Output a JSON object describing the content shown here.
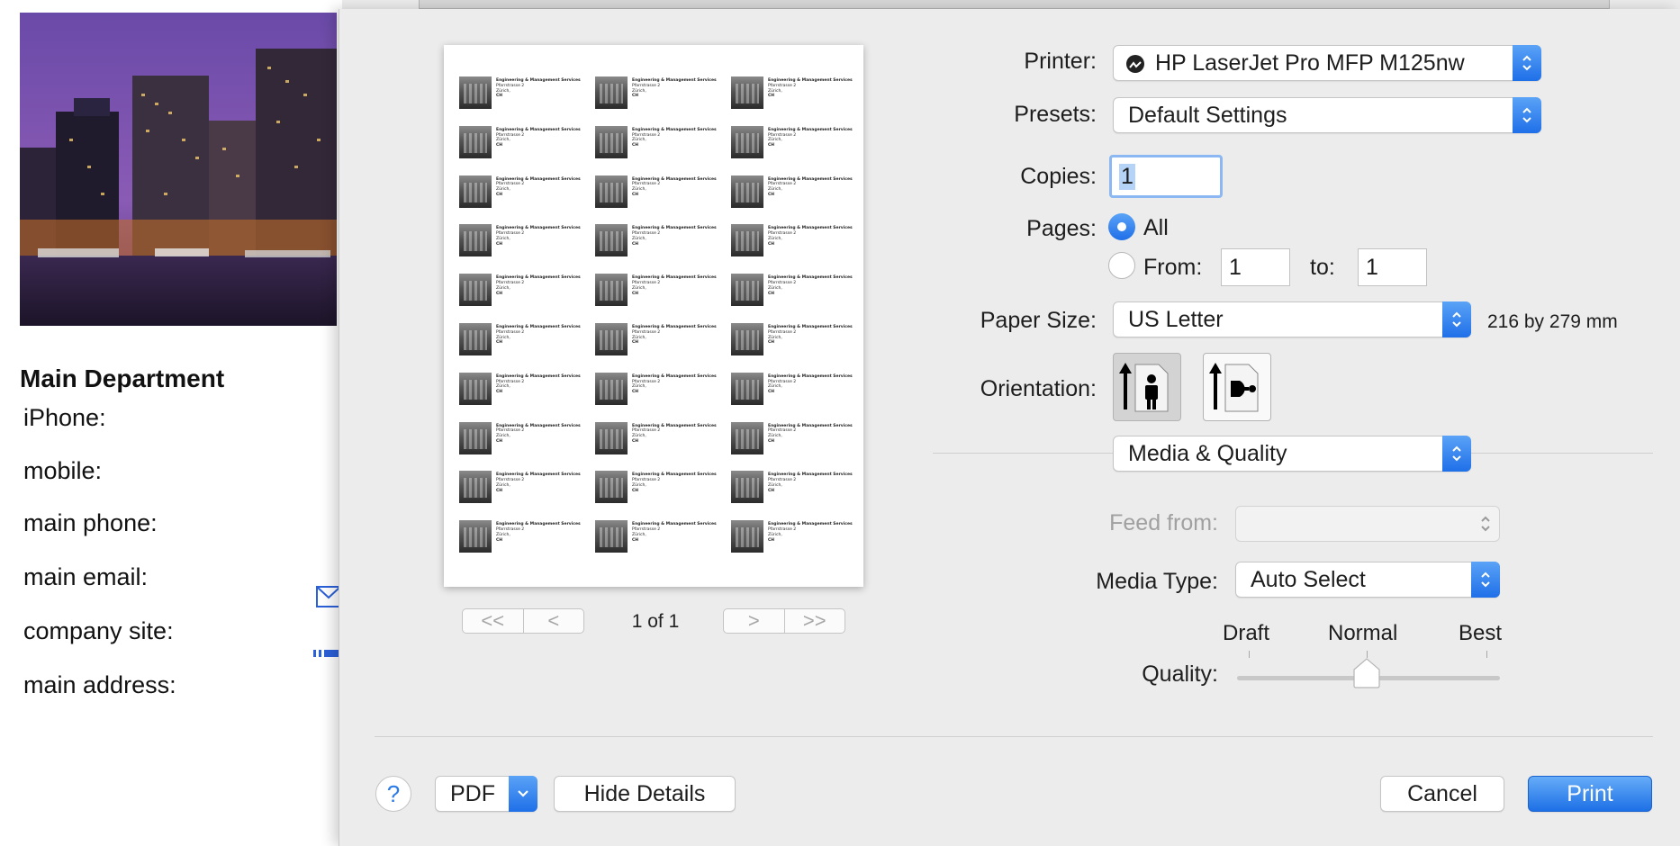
{
  "background_app": {
    "department_title": "Main Department",
    "labels": [
      "iPhone:",
      "mobile:",
      "main phone:",
      "main email:",
      "company site:",
      "main address:"
    ]
  },
  "preview": {
    "label_lines": [
      "Engineering & Management Services",
      "Pfarrstrasse 2",
      "Zürich,",
      "CH"
    ],
    "pager": {
      "first": "<<",
      "prev": "<",
      "page_count": "1 of 1",
      "next": ">",
      "last": ">>"
    }
  },
  "printer": {
    "label": "Printer:",
    "value": "HP LaserJet Pro MFP M125nw",
    "icon": "printer-status-icon"
  },
  "presets": {
    "label": "Presets:",
    "value": "Default Settings"
  },
  "copies": {
    "label": "Copies:",
    "value": "1"
  },
  "pages": {
    "label": "Pages:",
    "all_label": "All",
    "all_selected": true,
    "from_label": "From:",
    "from_value": "1",
    "to_label": "to:",
    "to_value": "1"
  },
  "paper_size": {
    "label": "Paper Size:",
    "value": "US Letter",
    "dimensions": "216 by 279 mm"
  },
  "orientation": {
    "label": "Orientation:",
    "selected": "portrait",
    "options": [
      "portrait",
      "landscape"
    ]
  },
  "section_menu": {
    "value": "Media & Quality"
  },
  "feed_from": {
    "label": "Feed from:",
    "value": "",
    "enabled": false
  },
  "media_type": {
    "label": "Media Type:",
    "value": "Auto Select"
  },
  "quality": {
    "label": "Quality:",
    "levels": [
      "Draft",
      "Normal",
      "Best"
    ],
    "selected": "Normal"
  },
  "buttons": {
    "help": "?",
    "pdf": "PDF",
    "hide_details": "Hide Details",
    "cancel": "Cancel",
    "print": "Print"
  },
  "colors": {
    "accent": "#1f6fe8",
    "sheet_bg": "#ececec"
  }
}
